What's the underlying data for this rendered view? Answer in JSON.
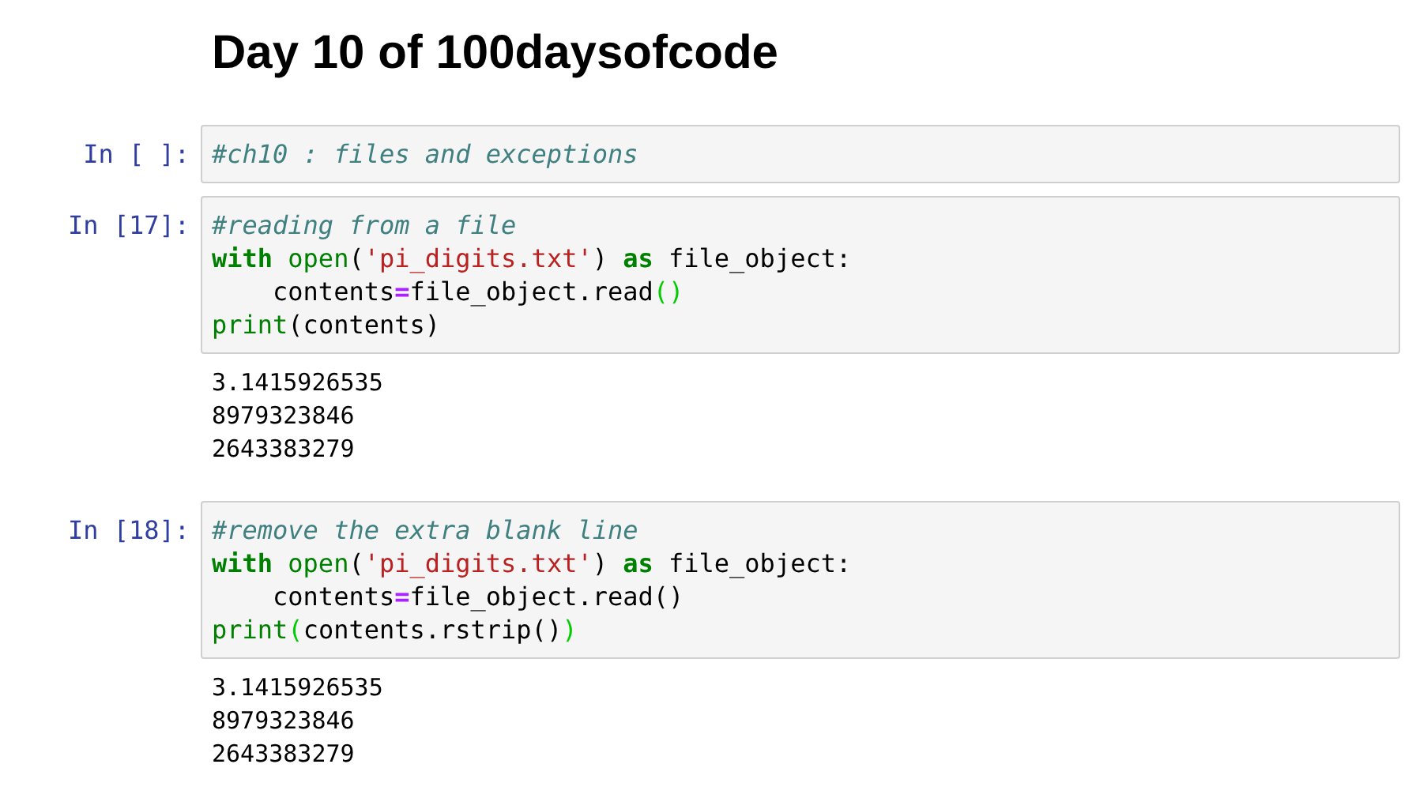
{
  "heading": "Day 10 of 100daysofcode",
  "cells": [
    {
      "prompt": "In [ ]:",
      "code": [
        [
          {
            "kind": "comment",
            "text": "#ch10 : files and exceptions"
          }
        ]
      ]
    },
    {
      "prompt": "In [17]:",
      "code": [
        [
          {
            "kind": "comment",
            "text": "#reading from a file"
          }
        ],
        [
          {
            "kind": "keyword",
            "text": "with"
          },
          {
            "kind": "builtin",
            "text": " open"
          },
          {
            "kind": "plain",
            "text": "("
          },
          {
            "kind": "string",
            "text": "'pi_digits.txt'"
          },
          {
            "kind": "plain",
            "text": ") "
          },
          {
            "kind": "keyword",
            "text": "as"
          },
          {
            "kind": "plain",
            "text": " file_object:"
          }
        ],
        [
          {
            "kind": "plain",
            "text": "    contents"
          },
          {
            "kind": "operator",
            "text": "="
          },
          {
            "kind": "plain",
            "text": "file_object.read"
          },
          {
            "kind": "match",
            "text": "()"
          }
        ],
        [
          {
            "kind": "builtin",
            "text": "print"
          },
          {
            "kind": "plain",
            "text": "(contents)"
          }
        ]
      ],
      "output": [
        "3.1415926535",
        "8979323846",
        "2643383279"
      ]
    },
    {
      "prompt": "In [18]:",
      "code": [
        [
          {
            "kind": "comment",
            "text": "#remove the extra blank line"
          }
        ],
        [
          {
            "kind": "keyword",
            "text": "with"
          },
          {
            "kind": "builtin",
            "text": " open"
          },
          {
            "kind": "plain",
            "text": "("
          },
          {
            "kind": "string",
            "text": "'pi_digits.txt'"
          },
          {
            "kind": "plain",
            "text": ") "
          },
          {
            "kind": "keyword",
            "text": "as"
          },
          {
            "kind": "plain",
            "text": " file_object:"
          }
        ],
        [
          {
            "kind": "plain",
            "text": "    contents"
          },
          {
            "kind": "operator",
            "text": "="
          },
          {
            "kind": "plain",
            "text": "file_object.read()"
          }
        ],
        [
          {
            "kind": "builtin",
            "text": "print"
          },
          {
            "kind": "match",
            "text": "("
          },
          {
            "kind": "plain",
            "text": "contents.rstrip()"
          },
          {
            "kind": "match",
            "text": ")"
          }
        ]
      ],
      "output": [
        "3.1415926535",
        "8979323846",
        "2643383279"
      ]
    }
  ]
}
